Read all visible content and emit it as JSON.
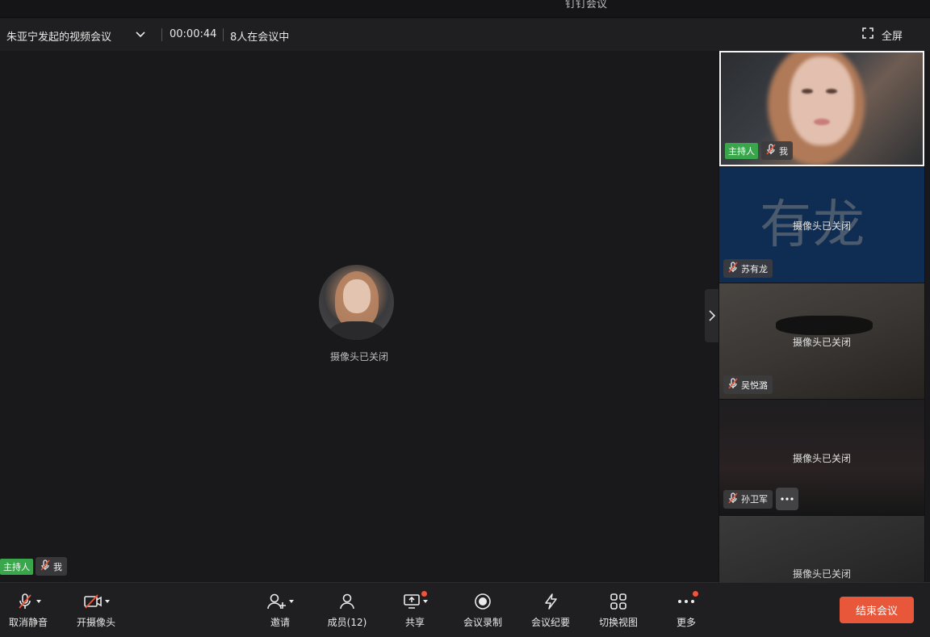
{
  "window": {
    "title": "钉钉会议"
  },
  "infobar": {
    "meeting_title": "朱亚宁发起的视频会议",
    "timer": "00:00:44",
    "participant_count": "8人在会议中",
    "fullscreen_label": "全屏"
  },
  "stage": {
    "camera_status": "摄像头已关闭",
    "host_tag": "主持人",
    "self_name": "我"
  },
  "side_tiles": [
    {
      "name": "我",
      "host_tag": "主持人",
      "camera_status": ""
    },
    {
      "name": "苏有龙",
      "camera_status": "摄像头已关闭",
      "avatar_text": "有龙"
    },
    {
      "name": "吴悦潞",
      "camera_status": "摄像头已关闭"
    },
    {
      "name": "孙卫军",
      "camera_status": "摄像头已关闭"
    },
    {
      "name": "",
      "camera_status": "摄像头已关闭"
    }
  ],
  "toolbar": {
    "unmute": "取消静音",
    "camera_on": "开摄像头",
    "invite": "邀请",
    "members": "成员(12)",
    "share": "共享",
    "record": "会议录制",
    "minutes": "会议纪要",
    "switch_view": "切换视图",
    "more": "更多",
    "end_meeting": "结束会议"
  },
  "colors": {
    "host_tag": "#3aa64c",
    "end_button": "#e8573a",
    "notification_dot": "#f0553a",
    "background": "#19191b"
  }
}
